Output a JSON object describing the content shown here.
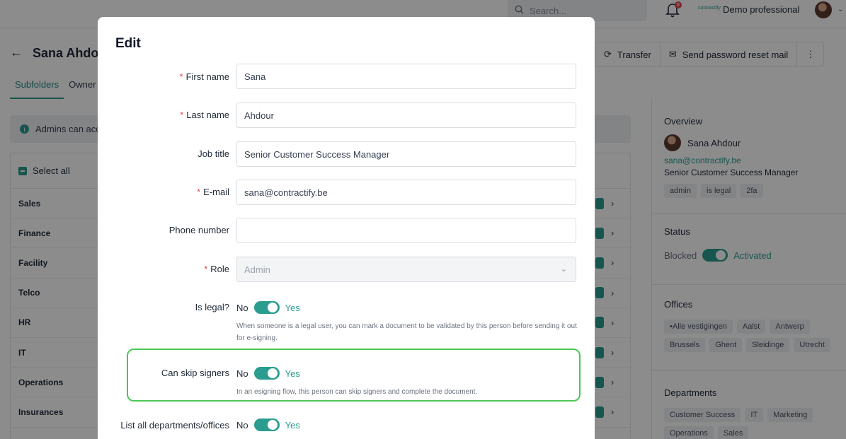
{
  "topbar": {
    "search_placeholder": "Search...",
    "notification_count": "8",
    "company_logo_text": "contractify",
    "company_name": "Demo professional"
  },
  "page": {
    "title": "Sana Ahdour",
    "tabs": [
      "Subfolders",
      "Owner"
    ],
    "actions": {
      "transfer": "Transfer",
      "send_reset": "Send password reset mail"
    },
    "info_text": "Admins can access all subfolders.",
    "select_all": "Select all",
    "folders": [
      "Sales",
      "Finance",
      "Facility",
      "Telco",
      "HR",
      "IT",
      "Operations",
      "Insurances"
    ]
  },
  "profile": {
    "overview_heading": "Overview",
    "name": "Sana Ahdour",
    "email": "sana@contractify.be",
    "job_title": "Senior Customer Success Manager",
    "tags": [
      "admin",
      "is legal",
      "2fa"
    ],
    "status_heading": "Status",
    "status_off": "Blocked",
    "status_on": "Activated",
    "offices_heading": "Offices",
    "offices": [
      "•Alle vestigingen",
      "Aalst",
      "Antwerp",
      "Brussels",
      "Ghent",
      "Sleidinge",
      "Utrecht"
    ],
    "departments_heading": "Departments",
    "departments": [
      "Customer Success",
      "IT",
      "Marketing",
      "Operations",
      "Sales"
    ]
  },
  "modal": {
    "title": "Edit",
    "first_name_label": "First name",
    "first_name_value": "Sana",
    "last_name_label": "Last name",
    "last_name_value": "Ahdour",
    "job_title_label": "Job title",
    "job_title_value": "Senior Customer Success Manager",
    "email_label": "E-mail",
    "email_value": "sana@contractify.be",
    "phone_label": "Phone number",
    "phone_value": "",
    "role_label": "Role",
    "role_value": "Admin",
    "is_legal_label": "Is legal?",
    "is_legal_help": "When someone is a legal user, you can mark a document to be validated by this person before sending it out for e-signing.",
    "skip_signers_label": "Can skip signers",
    "skip_signers_help": "In an esigning flow, this person can skip signers and complete the document.",
    "list_all_label": "List all departments/offices",
    "no_label": "No",
    "yes_label": "Yes"
  },
  "colors": {
    "accent": "#2a9d8f",
    "required": "#e5484d",
    "highlight": "#4cc757"
  }
}
